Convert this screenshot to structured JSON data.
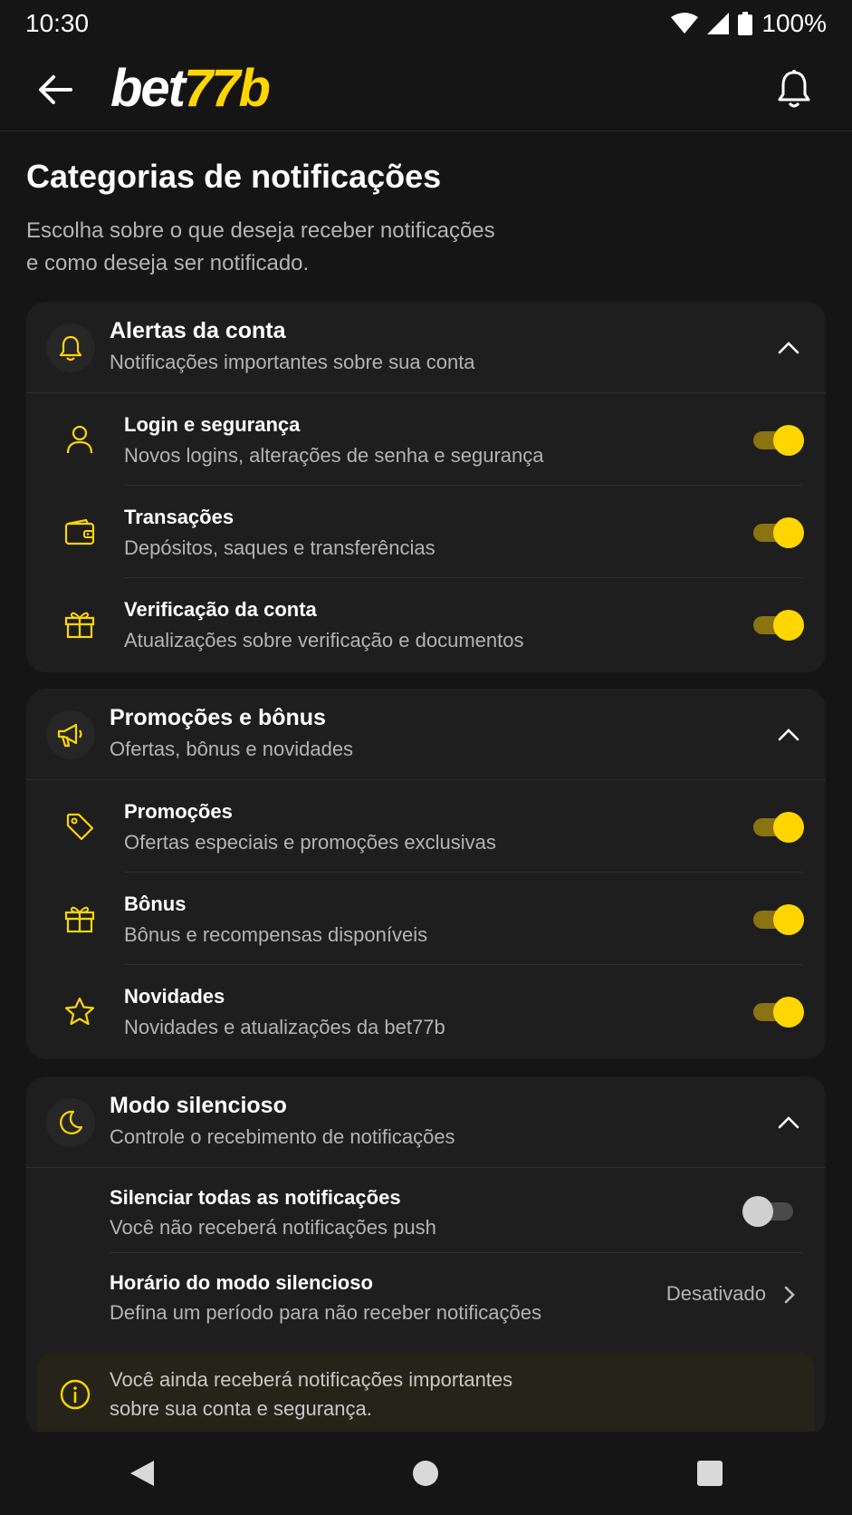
{
  "status": {
    "time": "10:30",
    "battery": "100%"
  },
  "app": {
    "logo_white": "bet",
    "logo_yellow": "77b"
  },
  "page": {
    "title": "Categorias de notificações",
    "subtitle_line1": "Escolha sobre o que deseja receber notificações",
    "subtitle_line2": "e como deseja ser notificado."
  },
  "colors": {
    "accent": "#ffd600",
    "background": "#151515",
    "card": "#1e1e1e"
  },
  "sections": [
    {
      "title": "Alertas da conta",
      "subtitle": "Notificações importantes sobre sua conta",
      "icon": "bell-icon",
      "items": [
        {
          "title": "Login e segurança",
          "subtitle": "Novos logins, alterações de senha e segurança",
          "icon": "user-icon",
          "enabled": true
        },
        {
          "title": "Transações",
          "subtitle": "Depósitos, saques e transferências",
          "icon": "wallet-icon",
          "enabled": true
        },
        {
          "title": "Verificação da conta",
          "subtitle": "Atualizações sobre verificação e documentos",
          "icon": "gift-icon",
          "enabled": true
        }
      ]
    },
    {
      "title": "Promoções e bônus",
      "subtitle": "Ofertas, bônus e novidades",
      "icon": "megaphone-icon",
      "items": [
        {
          "title": "Promoções",
          "subtitle": "Ofertas especiais e promoções exclusivas",
          "icon": "tag-icon",
          "enabled": true
        },
        {
          "title": "Bônus",
          "subtitle": "Bônus e recompensas disponíveis",
          "icon": "gift-icon",
          "enabled": true
        },
        {
          "title": "Novidades",
          "subtitle": "Novidades e atualizações da bet77b",
          "icon": "star-icon",
          "enabled": true
        }
      ]
    },
    {
      "title": "Modo silencioso",
      "subtitle": "Controle o recebimento de notificações",
      "icon": "moon-icon",
      "items": [
        {
          "title": "Silenciar todas as notificações",
          "subtitle": "Você não receberá notificações push",
          "enabled": false
        },
        {
          "title": "Horário do modo silencioso",
          "subtitle": "Defina um período para não receber notificações",
          "value": "Desativado"
        }
      ],
      "info_line1": "Você ainda receberá notificações importantes",
      "info_line2": "sobre sua conta e segurança."
    }
  ]
}
